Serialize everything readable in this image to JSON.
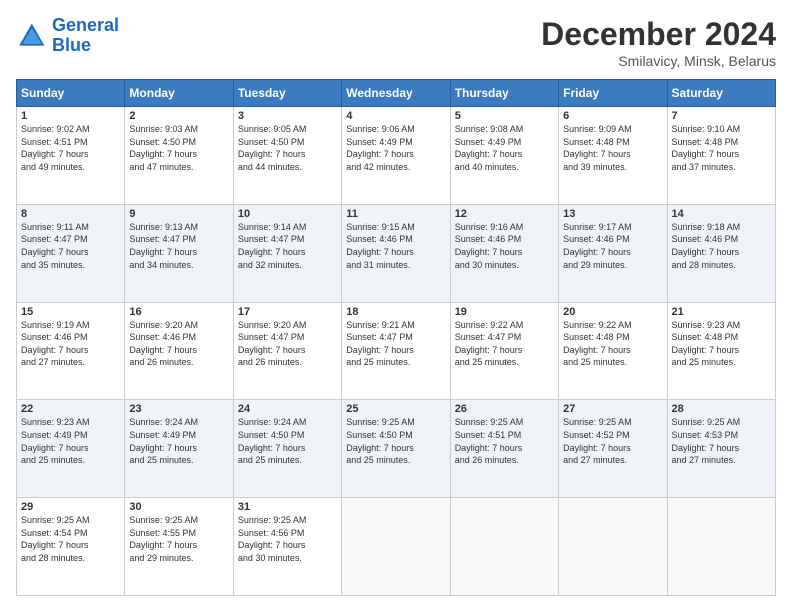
{
  "logo": {
    "line1": "General",
    "line2": "Blue"
  },
  "header": {
    "title": "December 2024",
    "subtitle": "Smilavicy, Minsk, Belarus"
  },
  "columns": [
    "Sunday",
    "Monday",
    "Tuesday",
    "Wednesday",
    "Thursday",
    "Friday",
    "Saturday"
  ],
  "weeks": [
    [
      {
        "day": "1",
        "sunrise": "9:02 AM",
        "sunset": "4:51 PM",
        "daylight": "7 hours and 49 minutes."
      },
      {
        "day": "2",
        "sunrise": "9:03 AM",
        "sunset": "4:50 PM",
        "daylight": "7 hours and 47 minutes."
      },
      {
        "day": "3",
        "sunrise": "9:05 AM",
        "sunset": "4:50 PM",
        "daylight": "7 hours and 44 minutes."
      },
      {
        "day": "4",
        "sunrise": "9:06 AM",
        "sunset": "4:49 PM",
        "daylight": "7 hours and 42 minutes."
      },
      {
        "day": "5",
        "sunrise": "9:08 AM",
        "sunset": "4:49 PM",
        "daylight": "7 hours and 40 minutes."
      },
      {
        "day": "6",
        "sunrise": "9:09 AM",
        "sunset": "4:48 PM",
        "daylight": "7 hours and 39 minutes."
      },
      {
        "day": "7",
        "sunrise": "9:10 AM",
        "sunset": "4:48 PM",
        "daylight": "7 hours and 37 minutes."
      }
    ],
    [
      {
        "day": "8",
        "sunrise": "9:11 AM",
        "sunset": "4:47 PM",
        "daylight": "7 hours and 35 minutes."
      },
      {
        "day": "9",
        "sunrise": "9:13 AM",
        "sunset": "4:47 PM",
        "daylight": "7 hours and 34 minutes."
      },
      {
        "day": "10",
        "sunrise": "9:14 AM",
        "sunset": "4:47 PM",
        "daylight": "7 hours and 32 minutes."
      },
      {
        "day": "11",
        "sunrise": "9:15 AM",
        "sunset": "4:46 PM",
        "daylight": "7 hours and 31 minutes."
      },
      {
        "day": "12",
        "sunrise": "9:16 AM",
        "sunset": "4:46 PM",
        "daylight": "7 hours and 30 minutes."
      },
      {
        "day": "13",
        "sunrise": "9:17 AM",
        "sunset": "4:46 PM",
        "daylight": "7 hours and 29 minutes."
      },
      {
        "day": "14",
        "sunrise": "9:18 AM",
        "sunset": "4:46 PM",
        "daylight": "7 hours and 28 minutes."
      }
    ],
    [
      {
        "day": "15",
        "sunrise": "9:19 AM",
        "sunset": "4:46 PM",
        "daylight": "7 hours and 27 minutes."
      },
      {
        "day": "16",
        "sunrise": "9:20 AM",
        "sunset": "4:46 PM",
        "daylight": "7 hours and 26 minutes."
      },
      {
        "day": "17",
        "sunrise": "9:20 AM",
        "sunset": "4:47 PM",
        "daylight": "7 hours and 26 minutes."
      },
      {
        "day": "18",
        "sunrise": "9:21 AM",
        "sunset": "4:47 PM",
        "daylight": "7 hours and 25 minutes."
      },
      {
        "day": "19",
        "sunrise": "9:22 AM",
        "sunset": "4:47 PM",
        "daylight": "7 hours and 25 minutes."
      },
      {
        "day": "20",
        "sunrise": "9:22 AM",
        "sunset": "4:48 PM",
        "daylight": "7 hours and 25 minutes."
      },
      {
        "day": "21",
        "sunrise": "9:23 AM",
        "sunset": "4:48 PM",
        "daylight": "7 hours and 25 minutes."
      }
    ],
    [
      {
        "day": "22",
        "sunrise": "9:23 AM",
        "sunset": "4:49 PM",
        "daylight": "7 hours and 25 minutes."
      },
      {
        "day": "23",
        "sunrise": "9:24 AM",
        "sunset": "4:49 PM",
        "daylight": "7 hours and 25 minutes."
      },
      {
        "day": "24",
        "sunrise": "9:24 AM",
        "sunset": "4:50 PM",
        "daylight": "7 hours and 25 minutes."
      },
      {
        "day": "25",
        "sunrise": "9:25 AM",
        "sunset": "4:50 PM",
        "daylight": "7 hours and 25 minutes."
      },
      {
        "day": "26",
        "sunrise": "9:25 AM",
        "sunset": "4:51 PM",
        "daylight": "7 hours and 26 minutes."
      },
      {
        "day": "27",
        "sunrise": "9:25 AM",
        "sunset": "4:52 PM",
        "daylight": "7 hours and 27 minutes."
      },
      {
        "day": "28",
        "sunrise": "9:25 AM",
        "sunset": "4:53 PM",
        "daylight": "7 hours and 27 minutes."
      }
    ],
    [
      {
        "day": "29",
        "sunrise": "9:25 AM",
        "sunset": "4:54 PM",
        "daylight": "7 hours and 28 minutes."
      },
      {
        "day": "30",
        "sunrise": "9:25 AM",
        "sunset": "4:55 PM",
        "daylight": "7 hours and 29 minutes."
      },
      {
        "day": "31",
        "sunrise": "9:25 AM",
        "sunset": "4:56 PM",
        "daylight": "7 hours and 30 minutes."
      },
      null,
      null,
      null,
      null
    ]
  ]
}
